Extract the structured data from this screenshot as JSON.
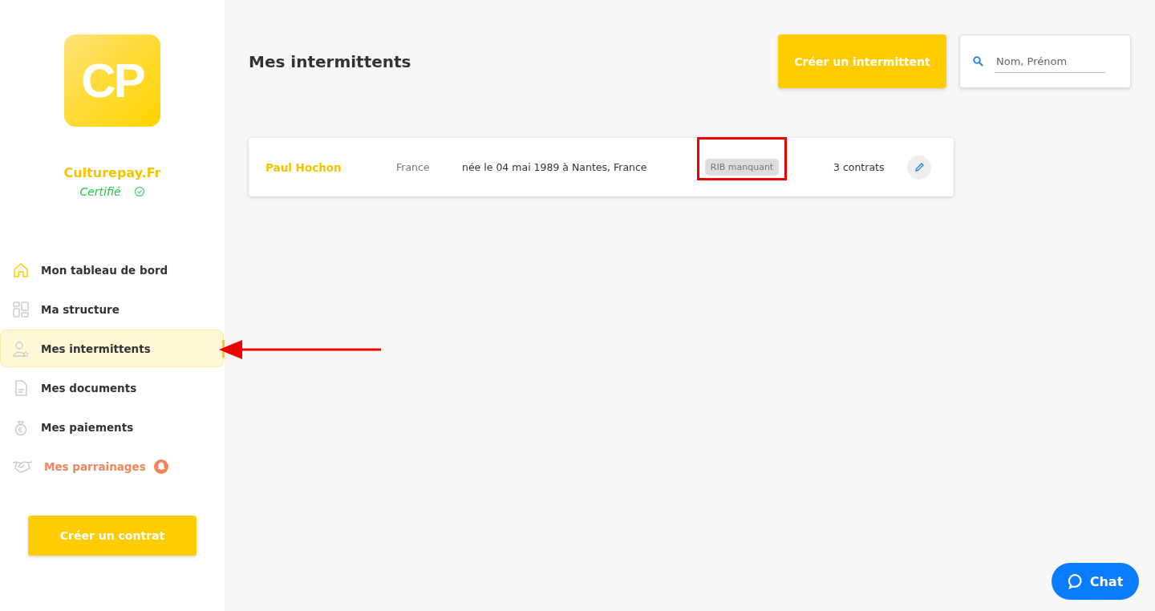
{
  "sidebar": {
    "logo_text": "CP",
    "brand": "Culturepay.Fr",
    "status": "Certifié",
    "verified": true,
    "items": [
      {
        "kind": "home",
        "label": "Mon tableau de bord",
        "selected": false,
        "alert": false
      },
      {
        "kind": "grid",
        "label": "Ma structure",
        "selected": false,
        "alert": false
      },
      {
        "kind": "person",
        "label": "Mes intermittents",
        "selected": true,
        "alert": false
      },
      {
        "kind": "document",
        "label": "Mes documents",
        "selected": false,
        "alert": false
      },
      {
        "kind": "money",
        "label": "Mes paiements",
        "selected": false,
        "alert": false
      },
      {
        "kind": "handshake",
        "label": "Mes parrainages",
        "selected": false,
        "alert": true
      }
    ],
    "button": "Créer un contrat"
  },
  "header": {
    "title": "Mes intermittents",
    "button": "Créer un intermittent",
    "search": {
      "placeholder": "Nom, Prénom"
    }
  },
  "rows": [
    {
      "name": "Paul Hochon",
      "country": "France",
      "birth": "née le 04 mai 1989 à Nantes, France",
      "badge": "RIB manquant",
      "contracts": "3 contrats"
    }
  ],
  "chat": {
    "label": "Chat"
  }
}
